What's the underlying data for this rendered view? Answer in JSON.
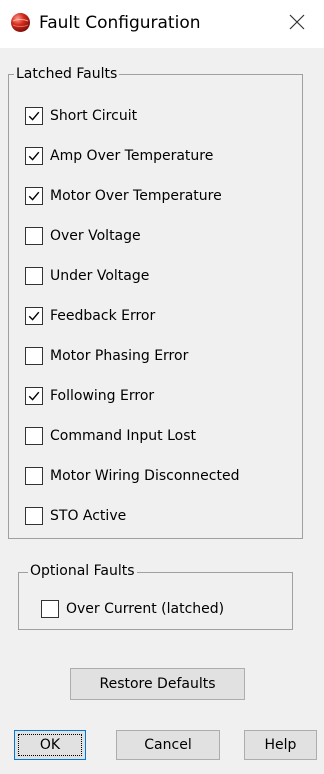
{
  "window": {
    "title": "Fault Configuration",
    "icon": "red-sphere-app-icon",
    "close_glyph": "✕"
  },
  "latched": {
    "legend": "Latched Faults",
    "items": [
      {
        "label": "Short Circuit",
        "checked": true
      },
      {
        "label": "Amp Over Temperature",
        "checked": true
      },
      {
        "label": "Motor Over Temperature",
        "checked": true
      },
      {
        "label": "Over Voltage",
        "checked": false
      },
      {
        "label": "Under Voltage",
        "checked": false
      },
      {
        "label": "Feedback Error",
        "checked": true
      },
      {
        "label": "Motor Phasing Error",
        "checked": false
      },
      {
        "label": "Following Error",
        "checked": true
      },
      {
        "label": "Command Input Lost",
        "checked": false
      },
      {
        "label": "Motor Wiring Disconnected",
        "checked": false
      },
      {
        "label": "STO Active",
        "checked": false
      }
    ]
  },
  "optional": {
    "legend": "Optional Faults",
    "items": [
      {
        "label": "Over Current (latched)",
        "checked": false
      }
    ]
  },
  "buttons": {
    "restore": "Restore Defaults",
    "ok": "OK",
    "cancel": "Cancel",
    "help": "Help"
  },
  "colors": {
    "window_bg": "#f0f0f0",
    "titlebar_bg": "#ffffff",
    "group_border": "#a0a0a0",
    "default_button_border": "#0078d7"
  }
}
